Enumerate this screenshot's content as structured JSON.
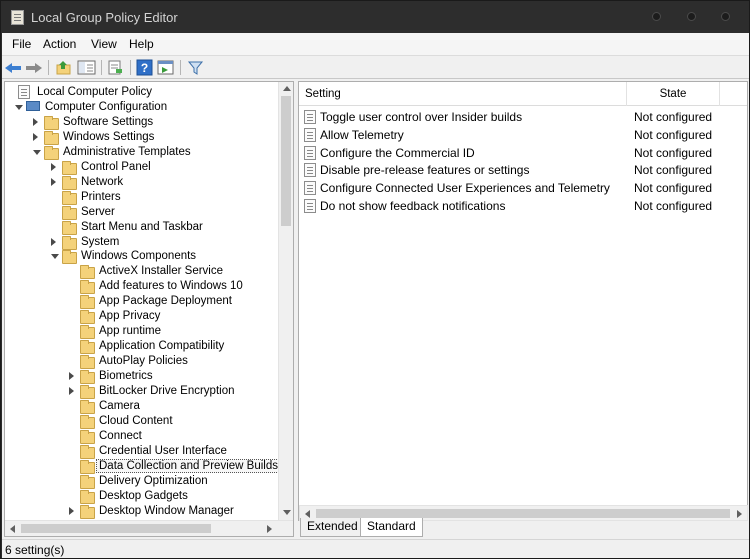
{
  "window": {
    "title": "Local Group Policy Editor"
  },
  "menu": [
    "File",
    "Action",
    "View",
    "Help"
  ],
  "tree": {
    "items": [
      {
        "label": "Local Computer Policy",
        "depth": 0,
        "toggle": "none",
        "icon": "doc"
      },
      {
        "label": "Computer Configuration",
        "depth": 1,
        "toggle": "expanded",
        "icon": "computer"
      },
      {
        "label": "Software Settings",
        "depth": 2,
        "toggle": "collapsed",
        "icon": "folder"
      },
      {
        "label": "Windows Settings",
        "depth": 2,
        "toggle": "collapsed",
        "icon": "folder"
      },
      {
        "label": "Administrative Templates",
        "depth": 2,
        "toggle": "expanded",
        "icon": "folder"
      },
      {
        "label": "Control Panel",
        "depth": 3,
        "toggle": "collapsed",
        "icon": "folder"
      },
      {
        "label": "Network",
        "depth": 3,
        "toggle": "collapsed",
        "icon": "folder"
      },
      {
        "label": "Printers",
        "depth": 3,
        "toggle": "none",
        "icon": "folder"
      },
      {
        "label": "Server",
        "depth": 3,
        "toggle": "none",
        "icon": "folder"
      },
      {
        "label": "Start Menu and Taskbar",
        "depth": 3,
        "toggle": "none",
        "icon": "folder"
      },
      {
        "label": "System",
        "depth": 3,
        "toggle": "collapsed",
        "icon": "folder"
      },
      {
        "label": "Windows Components",
        "depth": 3,
        "toggle": "expanded",
        "icon": "folder"
      },
      {
        "label": "ActiveX Installer Service",
        "depth": 4,
        "toggle": "none",
        "icon": "folder"
      },
      {
        "label": "Add features to Windows 10",
        "depth": 4,
        "toggle": "none",
        "icon": "folder"
      },
      {
        "label": "App Package Deployment",
        "depth": 4,
        "toggle": "none",
        "icon": "folder"
      },
      {
        "label": "App Privacy",
        "depth": 4,
        "toggle": "none",
        "icon": "folder"
      },
      {
        "label": "App runtime",
        "depth": 4,
        "toggle": "none",
        "icon": "folder"
      },
      {
        "label": "Application Compatibility",
        "depth": 4,
        "toggle": "none",
        "icon": "folder"
      },
      {
        "label": "AutoPlay Policies",
        "depth": 4,
        "toggle": "none",
        "icon": "folder"
      },
      {
        "label": "Biometrics",
        "depth": 4,
        "toggle": "collapsed",
        "icon": "folder"
      },
      {
        "label": "BitLocker Drive Encryption",
        "depth": 4,
        "toggle": "collapsed",
        "icon": "folder"
      },
      {
        "label": "Camera",
        "depth": 4,
        "toggle": "none",
        "icon": "folder"
      },
      {
        "label": "Cloud Content",
        "depth": 4,
        "toggle": "none",
        "icon": "folder"
      },
      {
        "label": "Connect",
        "depth": 4,
        "toggle": "none",
        "icon": "folder"
      },
      {
        "label": "Credential User Interface",
        "depth": 4,
        "toggle": "none",
        "icon": "folder"
      },
      {
        "label": "Data Collection and Preview Builds",
        "depth": 4,
        "toggle": "none",
        "icon": "folder",
        "selected": true
      },
      {
        "label": "Delivery Optimization",
        "depth": 4,
        "toggle": "none",
        "icon": "folder"
      },
      {
        "label": "Desktop Gadgets",
        "depth": 4,
        "toggle": "none",
        "icon": "folder"
      },
      {
        "label": "Desktop Window Manager",
        "depth": 4,
        "toggle": "collapsed",
        "icon": "folder"
      }
    ]
  },
  "list": {
    "columns": {
      "setting": "Setting",
      "state": "State"
    },
    "rows": [
      {
        "setting": "Toggle user control over Insider builds",
        "state": "Not configured"
      },
      {
        "setting": "Allow Telemetry",
        "state": "Not configured"
      },
      {
        "setting": "Configure the Commercial ID",
        "state": "Not configured"
      },
      {
        "setting": "Disable pre-release features or settings",
        "state": "Not configured"
      },
      {
        "setting": "Configure Connected User Experiences and Telemetry",
        "state": "Not configured"
      },
      {
        "setting": "Do not show feedback notifications",
        "state": "Not configured"
      }
    ]
  },
  "tabs": [
    {
      "label": "Extended",
      "active": false
    },
    {
      "label": "Standard",
      "active": true
    }
  ],
  "status": {
    "text": "6 setting(s)"
  },
  "toolbar": {
    "icons": [
      "back-arrow-icon",
      "forward-arrow-icon",
      "up-folder-icon",
      "show-hide-tree-icon",
      "export-list-icon",
      "help-icon",
      "properties-icon",
      "filter-icon"
    ]
  }
}
